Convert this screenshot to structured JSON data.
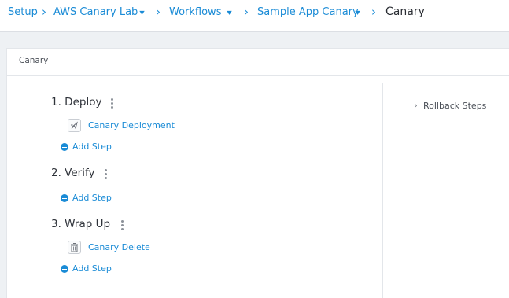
{
  "breadcrumb": {
    "items": [
      {
        "label": "Setup"
      },
      {
        "label": "AWS Canary Lab"
      },
      {
        "label": "Workflows"
      },
      {
        "label": "Sample App Canary"
      }
    ],
    "current": "Canary",
    "separator": "›",
    "caret": "▾"
  },
  "panel": {
    "title": "Canary"
  },
  "phases": [
    {
      "title": "1. Deploy",
      "steps": [
        {
          "label": "Canary Deployment",
          "icon": "deploy-icon"
        }
      ]
    },
    {
      "title": "2. Verify",
      "steps": []
    },
    {
      "title": "3. Wrap Up",
      "steps": [
        {
          "label": "Canary Delete",
          "icon": "trash-icon"
        }
      ]
    }
  ],
  "add_step_label": "Add Step",
  "rollback": {
    "label": "Rollback Steps",
    "chevron": "›"
  },
  "colors": {
    "link": "#1a8bd6",
    "text": "#2f333a",
    "background": "#eef1f4"
  }
}
